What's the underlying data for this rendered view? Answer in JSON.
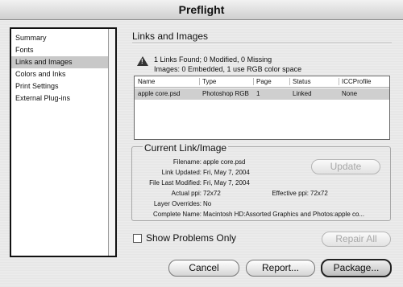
{
  "window": {
    "title": "Preflight"
  },
  "sidebar": {
    "items": [
      {
        "label": "Summary"
      },
      {
        "label": "Fonts"
      },
      {
        "label": "Links and Images"
      },
      {
        "label": "Colors and Inks"
      },
      {
        "label": "Print Settings"
      },
      {
        "label": "External Plug-ins"
      }
    ],
    "selected": "Links and Images"
  },
  "main": {
    "section_title": "Links and Images",
    "summary_line1": "1 Links Found; 0 Modified, 0 Missing",
    "summary_line2": "Images: 0 Embedded, 1 use RGB color space",
    "table": {
      "columns": [
        "Name",
        "Type",
        "Page",
        "Status",
        "ICCProfile"
      ],
      "rows": [
        [
          "apple core.psd",
          "Photoshop RGB",
          "1",
          "Linked",
          "None"
        ]
      ]
    },
    "current_link": {
      "title": "Current Link/Image",
      "filename_label": "Filename:",
      "filename": "apple core.psd",
      "link_updated_label": "Link Updated:",
      "link_updated": "Fri, May 7, 2004",
      "file_last_modified_label": "File Last Modified:",
      "file_last_modified": "Fri, May 7, 2004",
      "actual_ppi_label": "Actual ppi:",
      "actual_ppi": "72x72",
      "effective_ppi_label": "Effective ppi:",
      "effective_ppi": "72x72",
      "layer_overrides_label": "Layer Overrides:",
      "layer_overrides": "No",
      "complete_name_label": "Complete Name:",
      "complete_name": "Macintosh HD:Assorted Graphics and Photos:apple co...",
      "update_button": "Update"
    },
    "show_problems_only": "Show Problems Only",
    "show_problems_checked": false,
    "repair_all_button": "Repair All"
  },
  "buttons": {
    "cancel": "Cancel",
    "report": "Report...",
    "package": "Package..."
  }
}
